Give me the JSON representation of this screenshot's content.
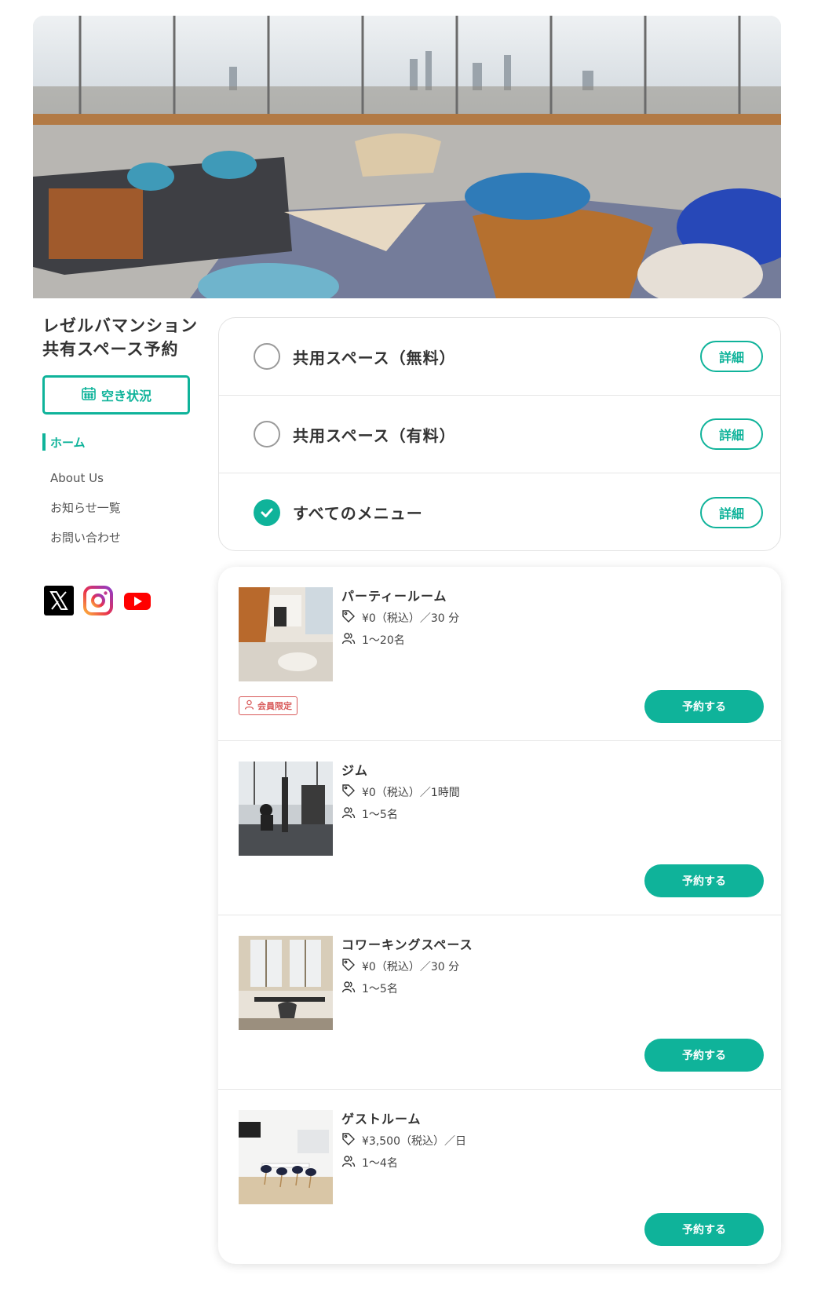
{
  "site": {
    "title_line1": "レゼルバマンション",
    "title_line2": "共有スペース予約"
  },
  "hero": {
    "alt": "lounge-photo"
  },
  "sidebar": {
    "availability_label": "空き状況",
    "nav": {
      "home": "ホーム",
      "items": [
        "About Us",
        "お知らせ一覧",
        "お問い合わせ"
      ]
    },
    "social": [
      "x-icon",
      "instagram-icon",
      "youtube-icon"
    ]
  },
  "filters": [
    {
      "label": "共用スペース（無料）",
      "checked": false,
      "detail_label": "詳細"
    },
    {
      "label": "共用スペース（有料）",
      "checked": false,
      "detail_label": "詳細"
    },
    {
      "label": "すべてのメニュー",
      "checked": true,
      "detail_label": "詳細"
    }
  ],
  "rooms": [
    {
      "name": "パーティールーム",
      "price": "¥0（税込）／30 分",
      "capacity": "1〜20名",
      "badge": "会員限定",
      "reserve_label": "予約する"
    },
    {
      "name": "ジム",
      "price": "¥0（税込）／1時間",
      "capacity": "1〜5名",
      "badge": "",
      "reserve_label": "予約する"
    },
    {
      "name": "コワーキングスペース",
      "price": "¥0（税込）／30 分",
      "capacity": "1〜5名",
      "badge": "",
      "reserve_label": "予約する"
    },
    {
      "name": "ゲストルーム",
      "price": "¥3,500（税込）／日",
      "capacity": "1〜4名",
      "badge": "",
      "reserve_label": "予約する"
    }
  ],
  "colors": {
    "accent": "#0fb39a",
    "badge": "#d85a5a",
    "text": "#333333"
  }
}
